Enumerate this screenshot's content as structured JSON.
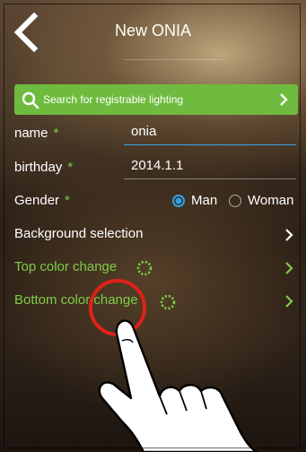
{
  "header": {
    "title": "New ONIA"
  },
  "search": {
    "label": "Search for registrable lighting"
  },
  "form": {
    "name": {
      "label": "name",
      "required_mark": "*",
      "value": "onia"
    },
    "birthday": {
      "label": "birthday",
      "required_mark": "*",
      "value": "2014.1.1"
    },
    "gender": {
      "label": "Gender",
      "required_mark": "*",
      "options": [
        {
          "label": "Man",
          "selected": true
        },
        {
          "label": "Woman",
          "selected": false
        }
      ]
    }
  },
  "menu": {
    "background_selection": "Background selection",
    "top_color_change": "Top color change",
    "bottom_color_change": "Bottom color change"
  },
  "colors": {
    "accent_green": "#6fbb3f",
    "label_green": "#7dcc4a",
    "radio_blue": "#2ea3ec",
    "touch_red": "#e0201a"
  },
  "icons": {
    "back": "chevron-left-icon",
    "search": "search-icon",
    "chevron": "chevron-right-icon",
    "color_gear": "gear-icon",
    "hand": "pointing-hand-icon",
    "touch": "touch-indicator-icon"
  }
}
